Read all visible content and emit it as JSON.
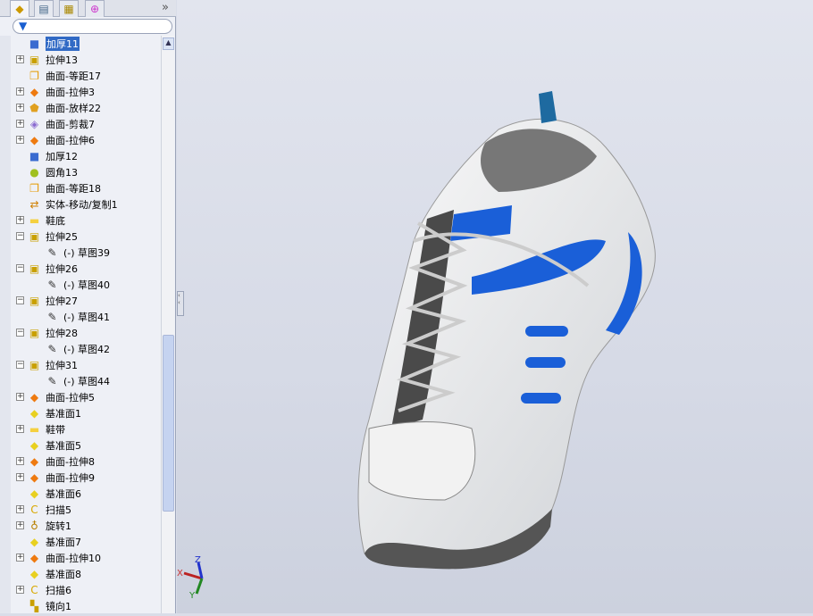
{
  "tabs": [
    {
      "name": "feature-manager",
      "icon": "feature-tree-icon"
    },
    {
      "name": "property-manager",
      "icon": "property-icon"
    },
    {
      "name": "configuration-manager",
      "icon": "configuration-icon"
    },
    {
      "name": "dimxpert",
      "icon": "crosshair-icon"
    }
  ],
  "more_label": "»",
  "filter_icon": "funnel-icon",
  "tree": [
    {
      "label": "加厚11",
      "icon": "thicken",
      "exp": "",
      "level": 0,
      "selected": true
    },
    {
      "label": "拉伸13",
      "icon": "extrude",
      "exp": "+",
      "level": 0
    },
    {
      "label": "曲面-等距17",
      "icon": "offset",
      "exp": "",
      "level": 0
    },
    {
      "label": "曲面-拉伸3",
      "icon": "surface-extrude",
      "exp": "+",
      "level": 0
    },
    {
      "label": "曲面-放样22",
      "icon": "loft",
      "exp": "+",
      "level": 0
    },
    {
      "label": "曲面-剪裁7",
      "icon": "trim",
      "exp": "+",
      "level": 0
    },
    {
      "label": "曲面-拉伸6",
      "icon": "surface-extrude",
      "exp": "+",
      "level": 0
    },
    {
      "label": "加厚12",
      "icon": "thicken",
      "exp": "",
      "level": 0
    },
    {
      "label": "圆角13",
      "icon": "fillet",
      "exp": "",
      "level": 0
    },
    {
      "label": "曲面-等距18",
      "icon": "offset",
      "exp": "",
      "level": 0
    },
    {
      "label": "实体-移动/复制1",
      "icon": "move",
      "exp": "",
      "level": 0
    },
    {
      "label": "鞋底",
      "icon": "folder",
      "exp": "+",
      "level": 0
    },
    {
      "label": "拉伸25",
      "icon": "extrude",
      "exp": "-",
      "level": 0
    },
    {
      "label": "(-) 草图39",
      "icon": "sketch",
      "exp": "",
      "level": 1
    },
    {
      "label": "拉伸26",
      "icon": "extrude",
      "exp": "-",
      "level": 0
    },
    {
      "label": "(-) 草图40",
      "icon": "sketch",
      "exp": "",
      "level": 1
    },
    {
      "label": "拉伸27",
      "icon": "extrude",
      "exp": "-",
      "level": 0
    },
    {
      "label": "(-) 草图41",
      "icon": "sketch",
      "exp": "",
      "level": 1
    },
    {
      "label": "拉伸28",
      "icon": "extrude",
      "exp": "-",
      "level": 0
    },
    {
      "label": "(-) 草图42",
      "icon": "sketch",
      "exp": "",
      "level": 1
    },
    {
      "label": "拉伸31",
      "icon": "extrude",
      "exp": "-",
      "level": 0
    },
    {
      "label": "(-) 草图44",
      "icon": "sketch",
      "exp": "",
      "level": 1
    },
    {
      "label": "曲面-拉伸5",
      "icon": "surface-extrude",
      "exp": "+",
      "level": 0
    },
    {
      "label": "基准面1",
      "icon": "plane",
      "exp": "",
      "level": 0
    },
    {
      "label": "鞋带",
      "icon": "folder",
      "exp": "+",
      "level": 0
    },
    {
      "label": "基准面5",
      "icon": "plane",
      "exp": "",
      "level": 0
    },
    {
      "label": "曲面-拉伸8",
      "icon": "surface-extrude",
      "exp": "+",
      "level": 0
    },
    {
      "label": "曲面-拉伸9",
      "icon": "surface-extrude",
      "exp": "+",
      "level": 0
    },
    {
      "label": "基准面6",
      "icon": "plane",
      "exp": "",
      "level": 0
    },
    {
      "label": "扫描5",
      "icon": "sweep",
      "exp": "+",
      "level": 0
    },
    {
      "label": "旋转1",
      "icon": "revolve",
      "exp": "+",
      "level": 0
    },
    {
      "label": "基准面7",
      "icon": "plane",
      "exp": "",
      "level": 0
    },
    {
      "label": "曲面-拉伸10",
      "icon": "surface-extrude",
      "exp": "+",
      "level": 0
    },
    {
      "label": "基准面8",
      "icon": "plane",
      "exp": "",
      "level": 0
    },
    {
      "label": "扫描6",
      "icon": "sweep",
      "exp": "+",
      "level": 0
    },
    {
      "label": "镜向1",
      "icon": "mirror",
      "exp": "",
      "level": 0
    }
  ],
  "triad": {
    "x": "X",
    "y": "Y",
    "z": "Z"
  },
  "colors": {
    "selection": "#316ac5",
    "shoe_accent": "#1a5fd8",
    "viewport": "#d9dde8"
  }
}
